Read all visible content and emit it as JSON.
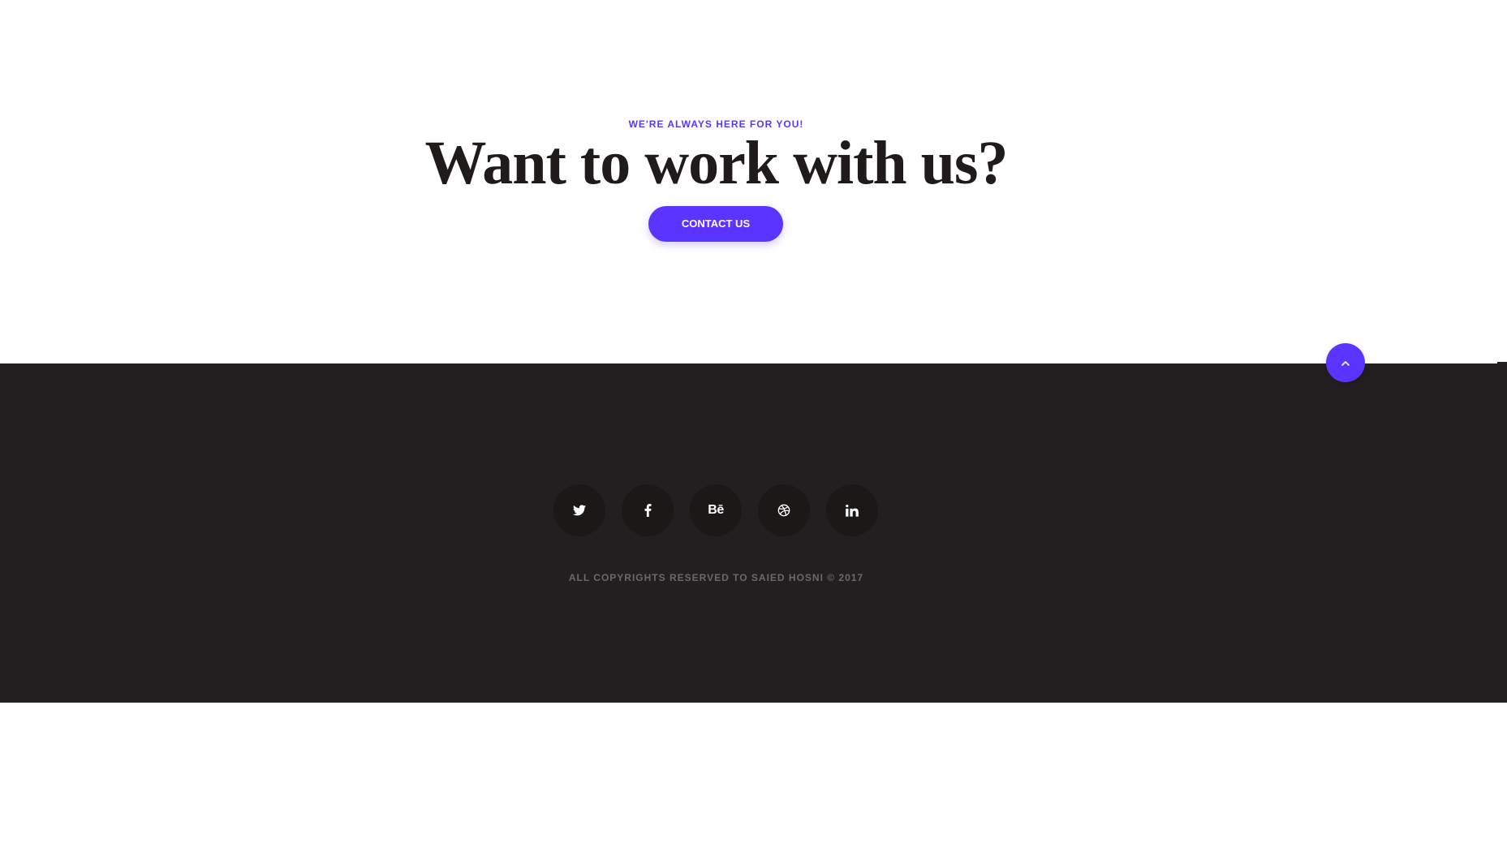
{
  "cta": {
    "kicker": "WE'RE ALWAYS HERE FOR YOU!",
    "title": "Want to work with us?",
    "button_label": "CONTACT US"
  },
  "footer": {
    "social": [
      {
        "name": "twitter",
        "icon": "twitter-icon"
      },
      {
        "name": "facebook",
        "icon": "facebook-icon"
      },
      {
        "name": "behance",
        "icon": "behance-icon",
        "glyph": "Bē"
      },
      {
        "name": "dribbble",
        "icon": "dribbble-icon"
      },
      {
        "name": "linkedin",
        "icon": "linkedin-icon"
      }
    ],
    "copyright": "ALL COPYRIGHTS RESERVED TO SAIED HOSNI © 2017"
  },
  "scroll_top": {
    "icon": "chevron-up-icon"
  },
  "colors": {
    "accent": "#5b34ff",
    "footer_bg": "#231f20",
    "social_bg": "#1b1818",
    "title_text": "#1f1b1b",
    "copyright_text": "#6d6868"
  }
}
